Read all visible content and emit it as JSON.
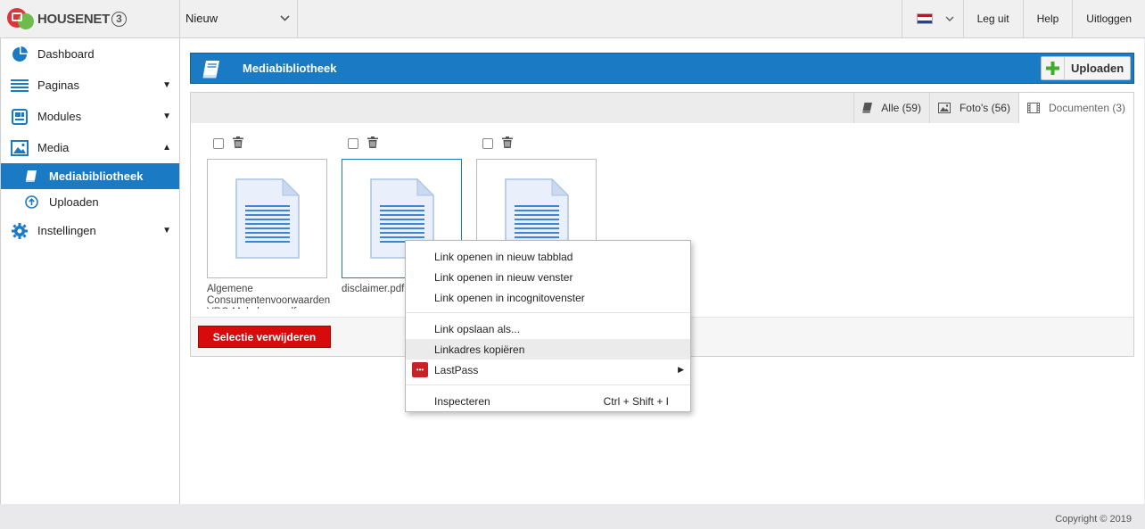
{
  "brand": {
    "name": "HOUSENET",
    "version": "3",
    "colors": {
      "accent": "#1a7bc4",
      "danger": "#d70b0b"
    }
  },
  "topbar": {
    "site_select": "Nieuw",
    "language_flag": "nl-flag-icon",
    "buttons": [
      "Leg uit",
      "Help",
      "Uitloggen"
    ]
  },
  "sidebar": {
    "items": [
      {
        "label": "Dashboard",
        "icon": "pie-chart-icon"
      },
      {
        "label": "Paginas",
        "icon": "list-icon",
        "caret": "▼"
      },
      {
        "label": "Modules",
        "icon": "modules-icon",
        "caret": "▼"
      },
      {
        "label": "Media",
        "icon": "image-icon",
        "caret": "▲"
      },
      {
        "label": "Instellingen",
        "icon": "gear-icon",
        "caret": "▼"
      }
    ],
    "media_sub": [
      {
        "label": "Mediabibliotheek",
        "icon": "book-icon",
        "active": true
      },
      {
        "label": "Uploaden",
        "icon": "upload-icon"
      }
    ]
  },
  "header": {
    "title": "Mediabibliotheek",
    "upload_label": "Uploaden"
  },
  "filters": [
    {
      "label": "Alle (59)",
      "icon": "book-icon"
    },
    {
      "label": "Foto's (56)",
      "icon": "image-icon"
    },
    {
      "label": "Documenten (3)",
      "icon": "film-icon",
      "active": true
    }
  ],
  "files": [
    {
      "name": "Algemene Consumentenvoorwaarden VRO Makelaars.pdf",
      "selected": false
    },
    {
      "name": "disclaimer.pdf",
      "selected": true
    },
    {
      "name": "",
      "selected": false
    }
  ],
  "delete_selection_label": "Selectie verwijderen",
  "context_menu": {
    "items": [
      "Link openen in nieuw tabblad",
      "Link openen in nieuw venster",
      "Link openen in incognitovenster",
      "Link opslaan als...",
      "Linkadres kopiëren",
      "LastPass",
      "Inspecteren"
    ],
    "inspect_shortcut": "Ctrl + Shift + I",
    "highlighted": "Linkadres kopiëren"
  },
  "footer": {
    "copyright": "Copyright © 2019"
  }
}
